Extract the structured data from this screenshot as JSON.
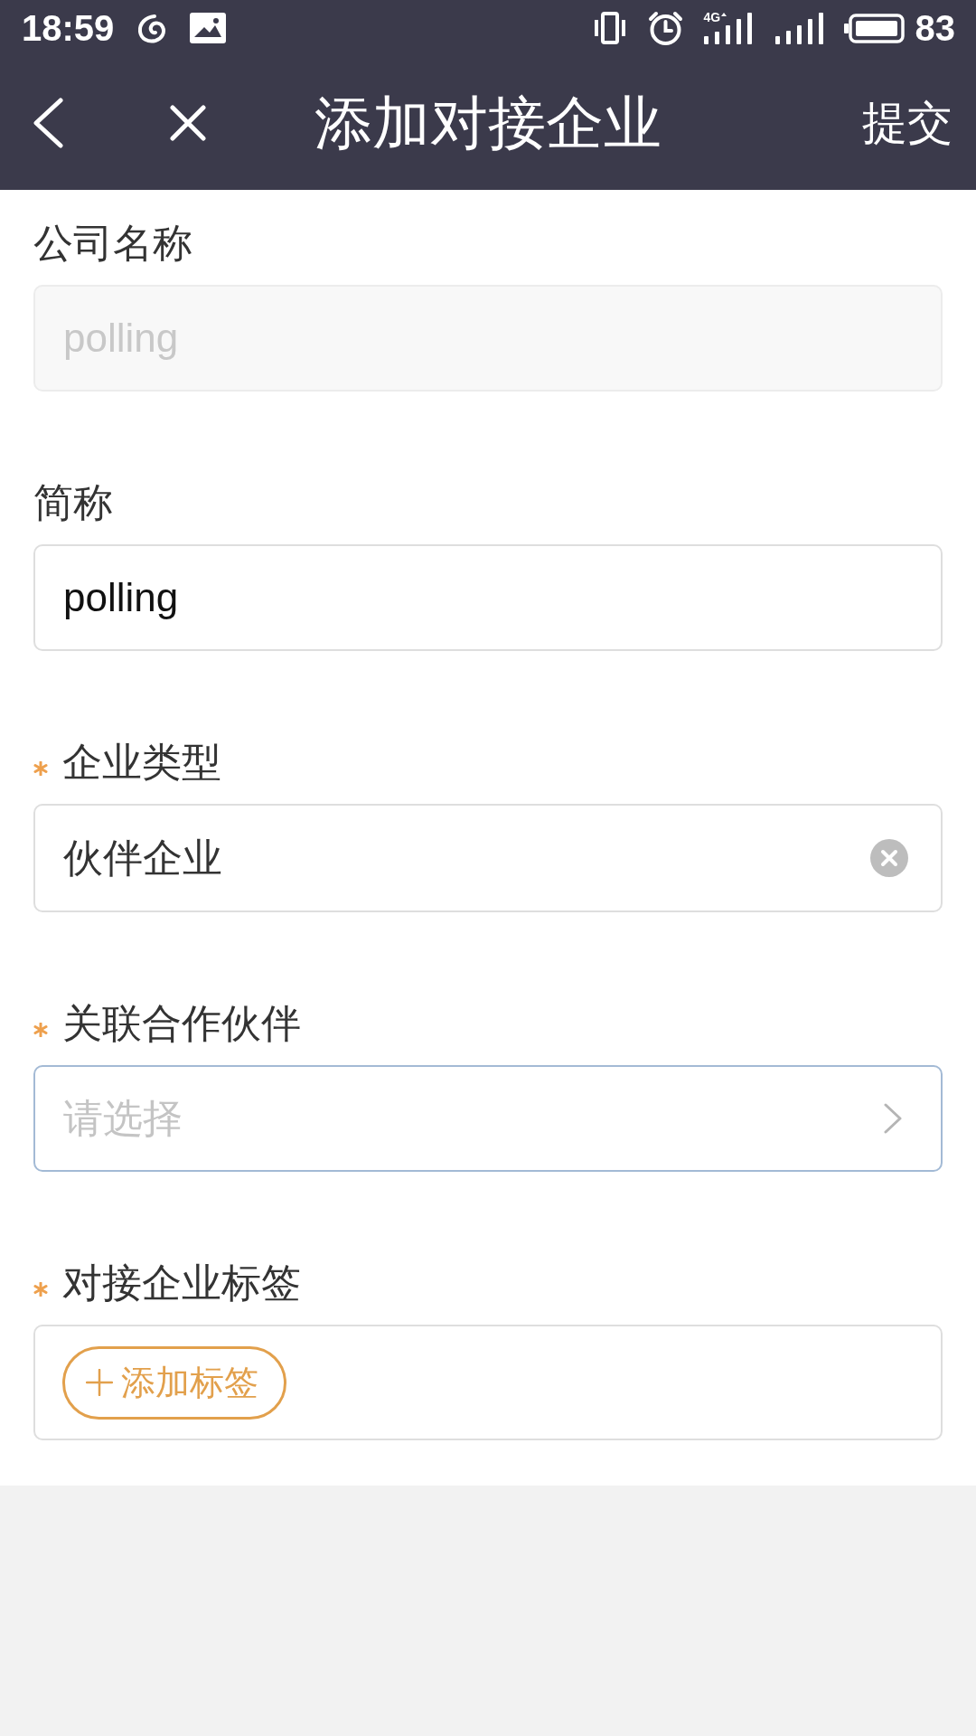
{
  "status_bar": {
    "time": "18:59",
    "network": "4G",
    "battery": "83"
  },
  "nav_bar": {
    "title": "添加对接企业",
    "action": "提交"
  },
  "form": {
    "fields": [
      {
        "kind": "text",
        "label": "公司名称",
        "required": false,
        "disabled": true,
        "focused": false,
        "value": "polling"
      },
      {
        "kind": "text",
        "label": "简称",
        "required": false,
        "disabled": false,
        "focused": false,
        "value": "polling"
      },
      {
        "kind": "clearable",
        "label": "企业类型",
        "required": true,
        "disabled": false,
        "focused": false,
        "value": "伙伴企业"
      },
      {
        "kind": "select",
        "label": "关联合作伙伴",
        "required": true,
        "disabled": false,
        "focused": true,
        "placeholder": "请选择"
      },
      {
        "kind": "tags",
        "label": "对接企业标签",
        "required": true,
        "disabled": false,
        "focused": false,
        "add_button": "添加标签"
      }
    ]
  }
}
